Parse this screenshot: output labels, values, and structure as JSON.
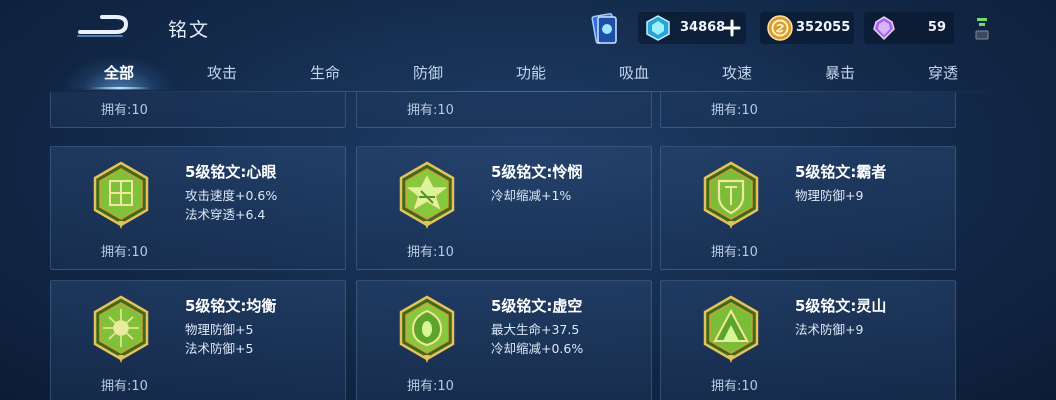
{
  "header": {
    "title": "铭文",
    "back_icon": "back-arrow-icon",
    "card_icon": "rune-card-icon"
  },
  "currencies": {
    "diamond": {
      "value": "34868",
      "icon": "diamond-coupon-icon",
      "color": "#7fe0ff"
    },
    "gold": {
      "value": "352055",
      "icon": "gold-coin-icon",
      "color": "#e0a23a"
    },
    "gem": {
      "value": "59",
      "icon": "purple-gem-icon",
      "color": "#c88cff"
    }
  },
  "tabs": [
    {
      "label": "全部"
    },
    {
      "label": "攻击"
    },
    {
      "label": "生命"
    },
    {
      "label": "防御"
    },
    {
      "label": "功能"
    },
    {
      "label": "吸血"
    },
    {
      "label": "攻速"
    },
    {
      "label": "暴击"
    },
    {
      "label": "穿透"
    }
  ],
  "active_tab": "全部",
  "accent_color": "#9ed86a",
  "cards": [
    {
      "owned": "拥有:10"
    },
    {
      "owned": "拥有:10"
    },
    {
      "owned": "拥有:10"
    },
    {
      "name": "5级铭文:心眼",
      "stats": [
        "攻击速度+0.6%",
        "法术穿透+6.4"
      ],
      "owned": "拥有:10",
      "icon": "rune-xinyan-icon"
    },
    {
      "name": "5级铭文:怜悯",
      "stats": [
        "冷却缩减+1%"
      ],
      "owned": "拥有:10",
      "icon": "rune-lianmin-icon"
    },
    {
      "name": "5级铭文:霸者",
      "stats": [
        "物理防御+9"
      ],
      "owned": "拥有:10",
      "icon": "rune-bazhe-icon"
    },
    {
      "name": "5级铭文:均衡",
      "stats": [
        "物理防御+5",
        "法术防御+5"
      ],
      "owned": "拥有:10",
      "icon": "rune-junheng-icon"
    },
    {
      "name": "5级铭文:虚空",
      "stats": [
        "最大生命+37.5",
        "冷却缩减+0.6%"
      ],
      "owned": "拥有:10",
      "icon": "rune-xukong-icon"
    },
    {
      "name": "5级铭文:灵山",
      "stats": [
        "法术防御+9"
      ],
      "owned": "拥有:10",
      "icon": "rune-lingshan-icon"
    }
  ]
}
